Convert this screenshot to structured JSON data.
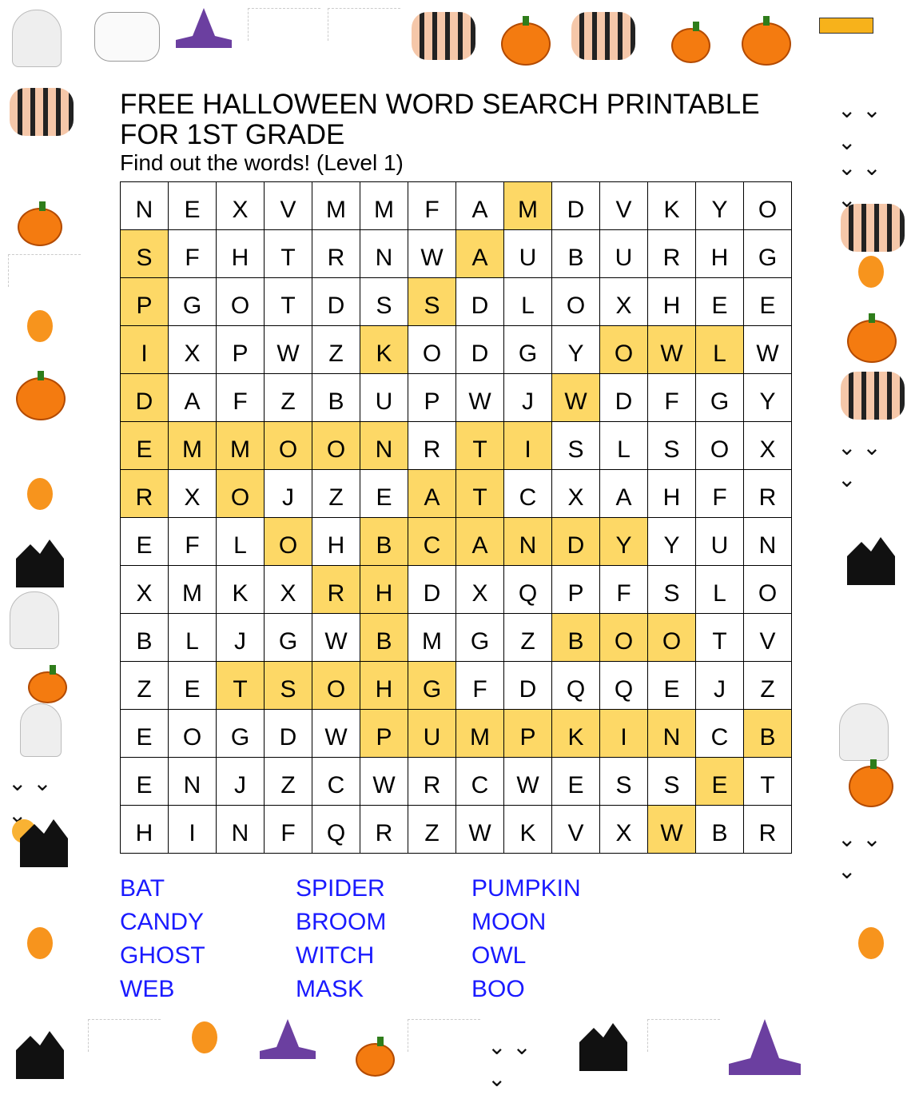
{
  "header": {
    "title": "FREE HALLOWEEN WORD SEARCH PRINTABLE FOR 1ST GRADE",
    "subtitle": "Find out the words! (Level 1)"
  },
  "grid": {
    "rows": [
      "NEXVMMFAMDVKYO",
      "SFHTRNWAUBURHG",
      "PGOTDSSDLOXHEE",
      "IXPWZKODGYOWLW",
      "DAFZBUPWJWDFGY",
      "EMMOONRTISLSOX",
      "RXOJZEATCXAHFR",
      "EFLOHBCANDYYUN",
      "XMKXRHDXQPFSLO",
      "BLJGWBMGZBOOTV",
      "ZETSOHGFDQQEJZ",
      "EOGDWPUMPKINCB",
      "ENJZCWRCWESSET",
      "HINFQRZWKVXWBR"
    ],
    "highlighted": [
      [
        8
      ],
      [
        0,
        7
      ],
      [
        0,
        6
      ],
      [
        0,
        5,
        10,
        11,
        12
      ],
      [
        0,
        9
      ],
      [
        0,
        1,
        2,
        3,
        4,
        5,
        7,
        8
      ],
      [
        0,
        2,
        6,
        7
      ],
      [
        3,
        5,
        6,
        7,
        8,
        9,
        10
      ],
      [
        4,
        5
      ],
      [
        5,
        9,
        10,
        11
      ],
      [
        2,
        3,
        4,
        5,
        6
      ],
      [
        5,
        6,
        7,
        8,
        9,
        10,
        11,
        13
      ],
      [
        12
      ],
      [
        11
      ]
    ],
    "highlight_color": "#fdd866"
  },
  "words": [
    "BAT",
    "SPIDER",
    "PUMPKIN",
    "CANDY",
    "BROOM",
    "MOON",
    "GHOST",
    "WITCH",
    "OWL",
    "WEB",
    "MASK",
    "BOO"
  ],
  "word_color": "#1a1aff"
}
